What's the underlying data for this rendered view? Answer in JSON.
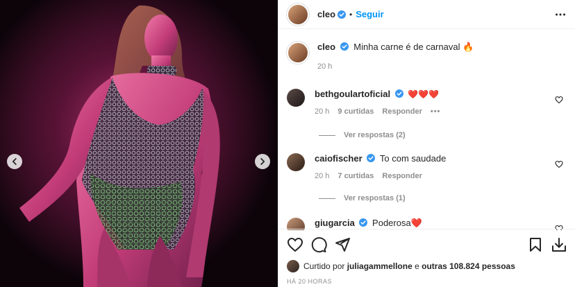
{
  "header": {
    "username": "cleo",
    "separator": "•",
    "follow_label": "Seguir"
  },
  "caption": {
    "username": "cleo",
    "text": "Minha carne é de carnaval 🔥",
    "time": "20 h"
  },
  "comments": [
    {
      "username": "bethgoulartoficial",
      "text": "❤️❤️❤️",
      "time": "20 h",
      "likes": "9 curtidas",
      "reply": "Responder",
      "more": "•••",
      "view_replies": "Ver respostas (2)"
    },
    {
      "username": "caiofischer",
      "text": "To com saudade",
      "time": "20 h",
      "likes": "7 curtidas",
      "reply": "Responder",
      "view_replies": "Ver respostas (1)"
    },
    {
      "username": "giugarcia",
      "text": "Poderosa❤️"
    }
  ],
  "likes": {
    "prefix": "Curtido por",
    "user": "juliagammellone",
    "middle": "e",
    "others": "outras 108.824 pessoas"
  },
  "timestamp": "HÁ 20 HORAS",
  "colors": {
    "accent": "#0095f6",
    "verified": "#3897f0",
    "muted": "#8e8e8e",
    "media_bg": "#0c0409",
    "glow": "#e0508f"
  },
  "icons": [
    "chevron-left-icon",
    "chevron-right-icon",
    "more-icon",
    "verified-icon",
    "heart-icon",
    "comment-icon",
    "share-icon",
    "bookmark-icon",
    "download-icon"
  ]
}
